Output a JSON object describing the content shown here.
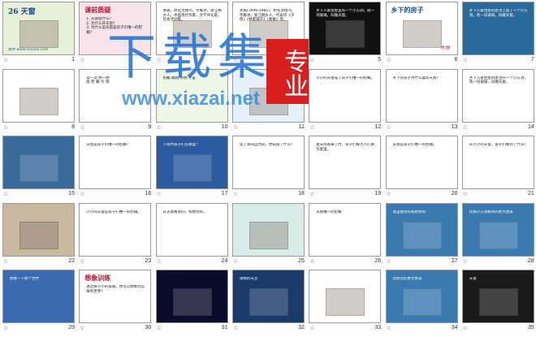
{
  "watermark": {
    "title": "下载集",
    "badge": "专业",
    "url": "www.xiazai.net"
  },
  "slides": [
    {
      "n": "1",
      "title": "26 天窗",
      "footer": "课件·www.xxxxxx.com",
      "bg": "#e8f1d8"
    },
    {
      "n": "2",
      "title": "课前质疑",
      "lines": "1. 天窗指什么?\n2. 为什么开天窗?\n3. 为什么说天窗是孩子们唯一的慰藉?",
      "bg": "#f7e3ea"
    },
    {
      "n": "3",
      "title": "",
      "lines": "茅盾，原名沈德鸿，字雁冰，浙江桐乡人。中国现代作家、文学评论家、社会活动家。",
      "bg": "#ffffff"
    },
    {
      "n": "4",
      "title": "",
      "lines": "茅盾(1896-1981)，原名沈德鸿，字雁冰，浙江桐乡人。代表作《子夜》《林家铺子》《春蚕》等。",
      "bg": "#ffffff"
    },
    {
      "n": "5",
      "title": "",
      "lines": "乡下人家住屋里有一个小方洞，嵌一块玻璃，叫做天窗。",
      "bg": "#111111"
    },
    {
      "n": "6",
      "title": "乡下的房子",
      "caption": "天窗",
      "bg": "#ffffff"
    },
    {
      "n": "7",
      "title": "",
      "lines": "乡下人家住屋的屋顶上留了一个小方洞，装一块玻璃，叫做天窗。",
      "bg": "#2a6a9a"
    },
    {
      "n": "8",
      "title": "",
      "bg": "#ffffff"
    },
    {
      "n": "9",
      "title": "",
      "lines": "读一读 想一想\n嵌 慰 藉 伶 俐",
      "bg": "#ffffff"
    },
    {
      "n": "10",
      "title": "",
      "lines": "慰藉 踢踏 伶俐 宇宙",
      "bg": "#eef6e6"
    },
    {
      "n": "11",
      "title": "",
      "bg": "#e6f0f8"
    },
    {
      "n": "12",
      "title": "",
      "lines": "小小的天窗成了孩子们唯一的慰藉。",
      "bg": "#ffffff"
    },
    {
      "n": "13",
      "title": "",
      "lines": "乡下的孩子为什么喜欢天窗？",
      "bg": "#ffffff"
    },
    {
      "n": "14",
      "title": "",
      "lines": "乡下人家住屋的屋顶开一个小方洞，装一块玻璃，叫做天窗。",
      "bg": "#ffffff"
    },
    {
      "n": "15",
      "title": "",
      "bg": "#3a6a9a"
    },
    {
      "n": "16",
      "title": "",
      "lines": "天窗是孩子们唯一的慰藉？",
      "bg": "#ffffff"
    },
    {
      "n": "17",
      "title": "",
      "lines": "下雨时孩子们在哪里？",
      "bg": "#2a5aa0"
    },
    {
      "n": "18",
      "title": "",
      "lines": "读了第四自然段，你知道了什么？",
      "bg": "#ffffff"
    },
    {
      "n": "19",
      "title": "",
      "lines": "夏天阵雨来了时，孩子们被大人们关在屋里。",
      "bg": "#ffffff"
    },
    {
      "n": "20",
      "title": "",
      "lines": "天窗是孩子们唯一的慰藉。",
      "bg": "#ffffff"
    },
    {
      "n": "21",
      "title": "",
      "lines": "从小小的天窗，孩子们看到了什么？",
      "bg": "#ffffff"
    },
    {
      "n": "22",
      "title": "",
      "bg": "#c8b8a0"
    },
    {
      "n": "23",
      "title": "",
      "lines": "小小的天窗是孩子们唯一的慰藉。",
      "bg": "#ffffff"
    },
    {
      "n": "24",
      "title": "",
      "lines": "从天窗看到的，和想到的。",
      "bg": "#ffffff"
    },
    {
      "n": "25",
      "title": "",
      "bg": "#d8ece8"
    },
    {
      "n": "26",
      "title": "",
      "lines": "天窗唯一的慰藉",
      "bg": "#ffffff"
    },
    {
      "n": "27",
      "title": "",
      "lines": "夜里看到的和想到的",
      "bg": "#3a7ab0"
    },
    {
      "n": "28",
      "title": "",
      "lines": "比那小方洞看到的更大更美",
      "bg": "#3a7ab0"
    },
    {
      "n": "29",
      "title": "",
      "lines": "想象一下那个世界",
      "bg": "#3a6ab0"
    },
    {
      "n": "30",
      "title": "想象训练",
      "lines": "透过那小小的玻璃，你可以想象到怎样的世界？",
      "bg": "#ffffff"
    },
    {
      "n": "31",
      "title": "",
      "bg": "#0a0a2a"
    },
    {
      "n": "32",
      "title": "",
      "lines": "夜晚的天空",
      "bg": "#1a3a6a"
    },
    {
      "n": "33",
      "title": "",
      "bg": "#ffffff"
    },
    {
      "n": "34",
      "title": "",
      "lines": "比所见的更大更美",
      "bg": "#3a7ab0"
    },
    {
      "n": "35",
      "title": "",
      "lines": "天窗",
      "bg": "#1a1a1a"
    }
  ],
  "colors": {
    "accent": "#1e90ff",
    "title_red": "#c8102e",
    "badge": "#d81e1e"
  }
}
